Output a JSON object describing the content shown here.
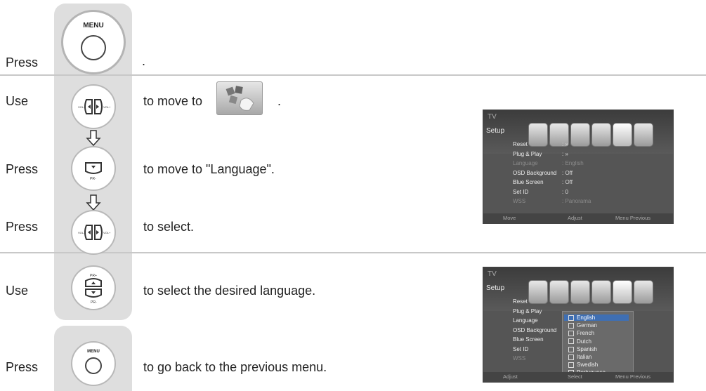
{
  "steps": {
    "press_1": "Press",
    "period_1": ".",
    "use_1": "Use",
    "move_to": "to move to",
    "period_2": ".",
    "press_2": "Press",
    "move_to_language": "to move to \"Language\".",
    "press_3": "Press",
    "to_select": "to select.",
    "use_2": "Use",
    "select_language": "to select the desired language.",
    "press_4": "Press",
    "go_back": "to go back to the previous menu."
  },
  "buttons": {
    "menu_label": "MENU",
    "pr_minus": "PR-",
    "pr_plus": "PR+",
    "vol_minus": "VOL-",
    "vol_plus": "VOL+"
  },
  "osd1": {
    "title": "TV",
    "menu": "Setup",
    "items": [
      {
        "label": "Reset",
        "value": ": »",
        "dim": false
      },
      {
        "label": "Plug & Play",
        "value": ": »",
        "dim": false
      },
      {
        "label": "Language",
        "value": ": English",
        "dim": true
      },
      {
        "label": "OSD Background",
        "value": ": Off",
        "dim": false
      },
      {
        "label": "Blue Screen",
        "value": ": Off",
        "dim": false
      },
      {
        "label": "Set ID",
        "value": ": 0",
        "dim": false
      },
      {
        "label": "WSS",
        "value": ": Panorama",
        "dim": true
      }
    ],
    "footer": {
      "move": "Move",
      "adjust": "Adjust",
      "prev": "Menu Previous"
    }
  },
  "osd2": {
    "title": "TV",
    "menu": "Setup",
    "items": [
      {
        "label": "Reset"
      },
      {
        "label": "Plug & Play"
      },
      {
        "label": "Language"
      },
      {
        "label": "OSD Background"
      },
      {
        "label": "Blue Screen"
      },
      {
        "label": "Set ID"
      },
      {
        "label": "WSS"
      }
    ],
    "languages": [
      "English",
      "German",
      "French",
      "Dutch",
      "Spanish",
      "Italian",
      "Swedish",
      "Portuguese"
    ],
    "footer": {
      "move": "Adjust",
      "adjust": "Select",
      "prev": "Menu Previous"
    }
  }
}
